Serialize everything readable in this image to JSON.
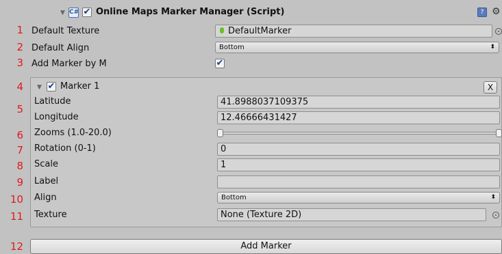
{
  "component": {
    "title": "Online Maps Marker Manager (Script)",
    "enabled": true,
    "help_icon": "help-book-icon",
    "settings_icon": "gear-icon",
    "script_icon": "script-icon"
  },
  "row_numbers": [
    "1",
    "2",
    "3",
    "4",
    "5",
    "6",
    "7",
    "8",
    "9",
    "10",
    "11",
    "12"
  ],
  "fields": {
    "default_texture_label": "Default Texture",
    "default_texture_value": "DefaultMarker",
    "default_align_label": "Default Align",
    "default_align_value": "Bottom",
    "add_marker_by_m_label": "Add Marker by M",
    "add_marker_by_m_checked": true
  },
  "marker": {
    "name": "Marker 1",
    "enabled": true,
    "remove_label": "X",
    "latitude_label": "Latitude",
    "latitude_value": "41.8988037109375",
    "longitude_label": "Longitude",
    "longitude_value": "12.46666431427",
    "zooms_label": "Zooms (1.0-20.0)",
    "zooms_range": [
      1.0,
      20.0
    ],
    "rotation_label": "Rotation (0-1)",
    "rotation_value": "0",
    "scale_label": "Scale",
    "scale_value": "1",
    "label_label": "Label",
    "label_value": "",
    "align_label": "Align",
    "align_value": "Bottom",
    "texture_label": "Texture",
    "texture_value": "None (Texture 2D)"
  },
  "add_marker_button": "Add Marker",
  "colors": {
    "background": "#c2c2c2",
    "row_number": "#e0191c",
    "checkbox_check": "#1e3f8a",
    "marker_pin": "#6cbf2a"
  }
}
